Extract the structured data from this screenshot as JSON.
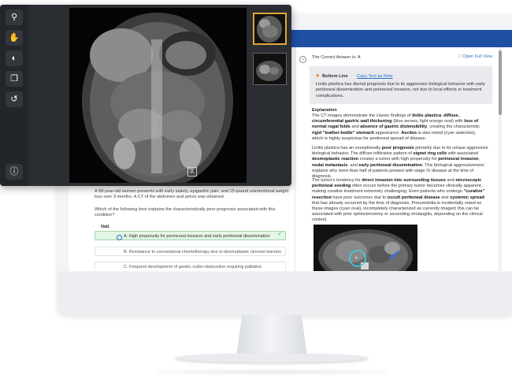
{
  "viewer": {
    "tools": [
      {
        "name": "zoom-tool",
        "icon": "magnifier-icon",
        "glyph": "⚲"
      },
      {
        "name": "pan-tool",
        "icon": "hand-icon",
        "glyph": "✋"
      },
      {
        "name": "contrast-tool",
        "icon": "contrast-icon",
        "glyph": "◐"
      },
      {
        "name": "window-tool",
        "icon": "copy-icon",
        "glyph": "❐"
      },
      {
        "name": "reset-tool",
        "icon": "undo-icon",
        "glyph": "↺"
      }
    ],
    "info_glyph": "ⓘ",
    "image_label": "A"
  },
  "question": {
    "stem": "A 58-year-old woman presents with early satiety, epigastric pain, and 15-pound unintentional weight loss over 3 months. A CT of the abdomen and pelvis was obtained.",
    "ask": "Which of the following best explains the characteristically poor prognosis associated with this condition?",
    "tag": "Natl.",
    "choices": [
      "A. High propensity for perineural invasion and early peritoneal dissemination",
      "B. Resistance to conventional chemotherapy due to desmoplastic stromal reaction",
      "C. Frequent development of gastric outlet obstruction requiring palliative"
    ],
    "check_glyph": "✓"
  },
  "explanation": {
    "expand_glyph": "»",
    "correct_answer": "The Correct Answer is: A",
    "open_full": "⛶ Open Full View",
    "bottom_line_star": "★",
    "bottom_line_label": "Bottom Line",
    "copy_text": "Copy Text as Note",
    "bottom_line_body": "Linitis plastica has dismal prognosis due to its aggressive biological behavior with early peritoneal dissemination and perineural invasion, not due to local effects or treatment complications.",
    "heading": "Explanation",
    "p1_a": "The CT images demonstrate the classic findings of ",
    "p1_b": "linitis plastica",
    "p1_c": ": ",
    "p1_d": "diffuse, circumferential gastric wall thickening",
    "p1_e": " (blue arrows, light orange oval) with ",
    "p1_f": "loss of normal rugal folds",
    "p1_g": " and ",
    "p1_h": "absence of gastric distensibility",
    "p1_i": ", creating the characteristic ",
    "p1_j": "rigid \"leather-bottle\" stomach",
    "p1_k": " appearance. ",
    "p1_l": "Ascites",
    "p1_m": " is also noted (cyan asterisks), which is highly suspicious for peritoneal spread of disease.",
    "p2_a": "Linitis plastica has an exceptionally ",
    "p2_b": "poor prognosis",
    "p2_c": " primarily due to its unique aggressive biological behavior. The diffuse infiltrative pattern of ",
    "p2_d": "signet ring cells",
    "p2_e": " with associated ",
    "p2_f": "desmoplastic reaction",
    "p2_g": " creates a tumor with high propensity for ",
    "p2_h": "perineural invasion",
    "p2_i": ", ",
    "p2_j": "nodal metastasis",
    "p2_k": ", and ",
    "p2_l": "early peritoneal dissemination",
    "p2_m": ". This biological aggressiveness explains why more than half of patients present with stage IV disease at the time of diagnosis.",
    "p3_a": "The tumor's tendency for ",
    "p3_b": "direct invasion into surrounding tissues",
    "p3_c": " and ",
    "p3_d": "microscopic peritoneal seeding",
    "p3_e": " often occurs before the primary tumor becomes clinically apparent, making curative treatment extremely challenging. Even patients who undergo ",
    "p3_f": "\"curative\" resection",
    "p3_g": " have poor outcomes due to ",
    "p3_h": "occult peritoneal disease",
    "p3_i": " and ",
    "p3_j": "systemic spread",
    "p3_k": " that has already occurred by the time of diagnosis. Pneumobilia is incidentally noted on these images (cyan oval), incompletely characterized as currently imaged; this can be associated with prior sphincterotomy or ascending cholangitis, depending on the clinical context."
  },
  "colors": {
    "header_blue": "#1f4fa3",
    "correct_green": "#e3f5e6",
    "link_blue": "#2f6ec9",
    "thumb_active": "#e0a63a"
  }
}
